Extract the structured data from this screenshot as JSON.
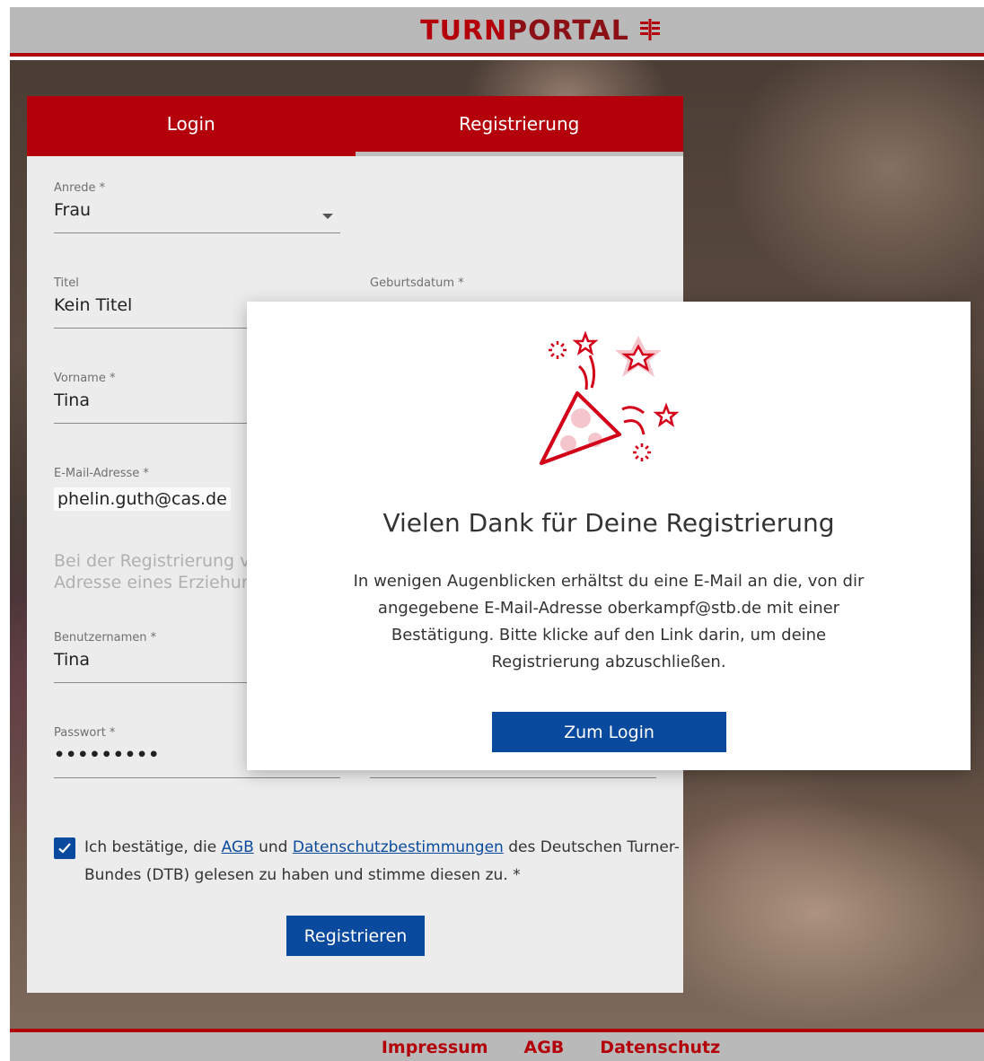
{
  "header": {
    "brand_part1": "TURN",
    "brand_part2": "PORTAL",
    "brand_icon": "dtb-logo-icon"
  },
  "tabs": [
    {
      "label": "Login",
      "active": false
    },
    {
      "label": "Registrierung",
      "active": true
    }
  ],
  "form": {
    "salutation": {
      "label": "Anrede *",
      "value": "Frau"
    },
    "title": {
      "label": "Titel",
      "value": "Kein Titel"
    },
    "birthdate": {
      "label": "Geburtsdatum *"
    },
    "firstname": {
      "label": "Vorname *",
      "value": "Tina"
    },
    "email": {
      "label": "E-Mail-Adresse *",
      "value": "phelin.guth@cas.de"
    },
    "hint_line1": "Bei der Registrierung v",
    "hint_line2": "Adresse eines Erziehur",
    "username": {
      "label": "Benutzernamen *",
      "value": "Tina"
    },
    "password": {
      "label": "Passwort *",
      "value": "•••••••••"
    },
    "consent": {
      "text_pre": "Ich bestätige, die ",
      "agb_link": "AGB",
      "text_mid": " und ",
      "privacy_link": "Datenschutzbestimmungen",
      "text_post": " des Deutschen Turner-Bundes (DTB) gelesen zu haben und stimme diesen zu. *",
      "checked": true
    },
    "register_button": "Registrieren"
  },
  "modal": {
    "title": "Vielen Dank für Deine Registrierung",
    "body": "In wenigen Augenblicken erhältst du eine E-Mail an die, von dir angegebene E-Mail-Adresse oberkampf@stb.de mit einer Bestätigung. Bitte klicke auf den Link darin, um deine Registrierung abzuschließen.",
    "button": "Zum Login",
    "illustration": "party-popper-icon"
  },
  "footer": {
    "links": [
      "Impressum",
      "AGB",
      "Datenschutz"
    ]
  },
  "colors": {
    "brand_red": "#b3000a",
    "primary_blue": "#0a4a9e",
    "header_gray": "#b9b9b9"
  }
}
